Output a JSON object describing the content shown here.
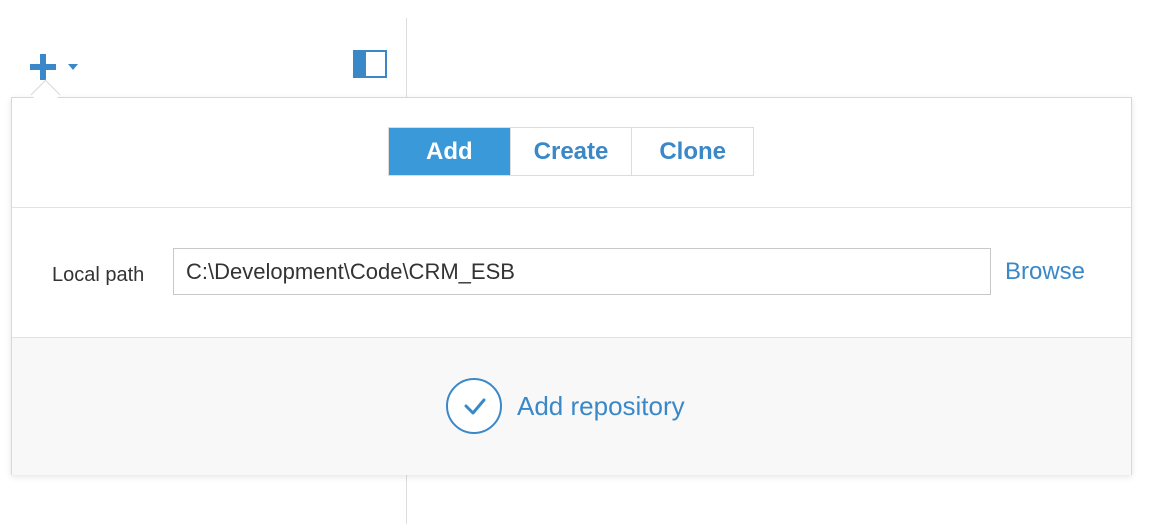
{
  "toolbar": {
    "add_menu_icon": "plus-icon",
    "add_menu_caret": "caret-down-icon",
    "panel_toggle_icon": "sidebar-toggle-icon"
  },
  "popover": {
    "tabs": [
      {
        "label": "Add",
        "active": true
      },
      {
        "label": "Create",
        "active": false
      },
      {
        "label": "Clone",
        "active": false
      }
    ],
    "local_path": {
      "label": "Local path",
      "value": "C:\\Development\\Code\\CRM_ESB",
      "browse_label": "Browse"
    },
    "submit": {
      "label": "Add repository",
      "icon": "checkmark-circle-icon"
    }
  },
  "colors": {
    "accent": "#3a88c8",
    "active_tab_bg": "#3a9ad9",
    "footer_bg": "#f8f8f8"
  }
}
